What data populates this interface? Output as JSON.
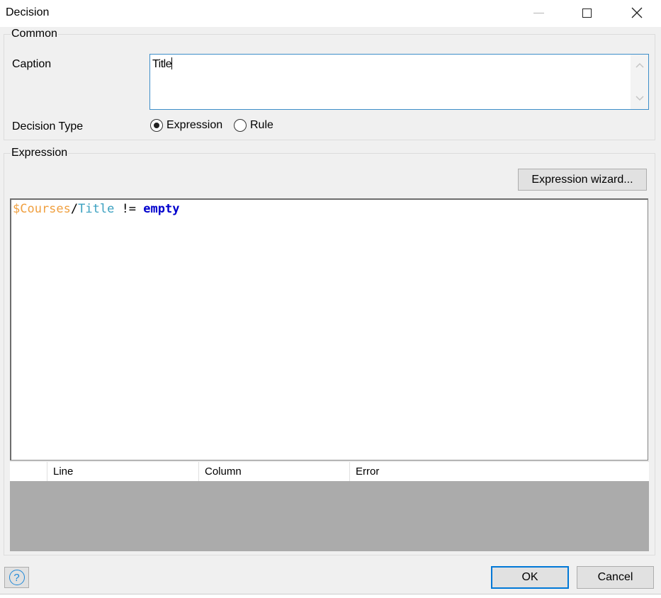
{
  "window": {
    "title": "Decision",
    "minimize_icon": "minimize-icon",
    "maximize_icon": "maximize-icon",
    "close_icon": "close-icon"
  },
  "common": {
    "group_label": "Common",
    "caption_label": "Caption",
    "caption_value": "Title",
    "decision_type_label": "Decision Type",
    "decision_type_options": [
      {
        "label": "Expression",
        "selected": true
      },
      {
        "label": "Rule",
        "selected": false
      }
    ]
  },
  "expression": {
    "group_label": "Expression",
    "wizard_button": "Expression wizard...",
    "code_tokens": [
      {
        "text": "$Courses",
        "kind": "variable",
        "color": "#f0a040"
      },
      {
        "text": "/",
        "kind": "operator",
        "color": "#000000"
      },
      {
        "text": "Title",
        "kind": "attribute",
        "color": "#3aa0c0"
      },
      {
        "text": " != ",
        "kind": "operator",
        "color": "#000000"
      },
      {
        "text": "empty",
        "kind": "keyword",
        "color": "#0000cd"
      }
    ]
  },
  "errors_table": {
    "columns": [
      "",
      "Line",
      "Column",
      "Error"
    ],
    "rows": []
  },
  "footer": {
    "help_icon": "help-icon",
    "ok_label": "OK",
    "cancel_label": "Cancel"
  },
  "colors": {
    "focus_border": "#0078d7",
    "dialog_background": "#f0f0f0",
    "grid_empty_area": "#ababab"
  }
}
